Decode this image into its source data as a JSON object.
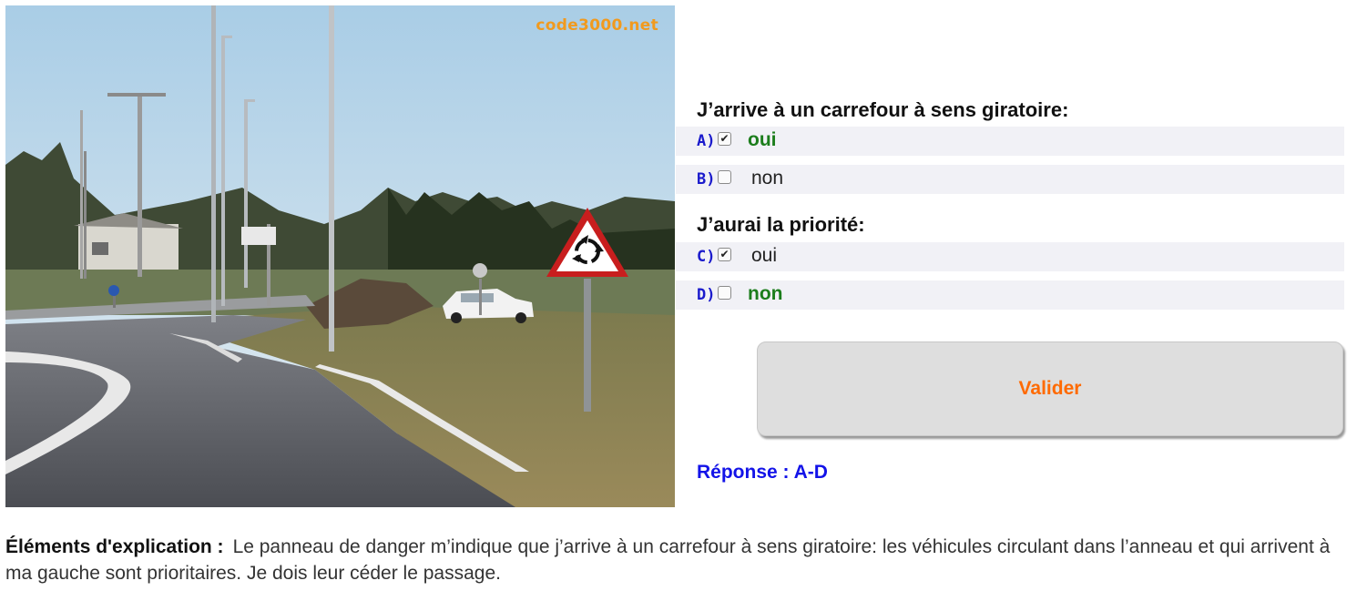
{
  "photo": {
    "watermark": "code3000.net"
  },
  "question1": {
    "title": "J’arrive à un carrefour à sens giratoire:",
    "options": [
      {
        "letter": "A)",
        "label": "oui",
        "checked": true,
        "correct": true
      },
      {
        "letter": "B)",
        "label": "non",
        "checked": false,
        "correct": false
      }
    ]
  },
  "question2": {
    "title": "J’aurai la priorité:",
    "options": [
      {
        "letter": "C)",
        "label": "oui",
        "checked": true,
        "correct": false
      },
      {
        "letter": "D)",
        "label": "non",
        "checked": false,
        "correct": true
      }
    ]
  },
  "submit": {
    "label": "Valider"
  },
  "answer": {
    "text": "Réponse : A-D"
  },
  "explanation": {
    "label": "Éléments d'explication :",
    "text": "Le panneau de danger m’indique que j’arrive à un carrefour à sens giratoire: les véhicules circulant dans l’anneau et qui arrivent à ma gauche sont prioritaires. Je dois leur céder le passage."
  },
  "colors": {
    "correct": "#1c7d1c",
    "letter": "#1a1acc",
    "button_text": "#ff6a00",
    "answer": "#1313e8",
    "watermark": "#f19a1e"
  }
}
